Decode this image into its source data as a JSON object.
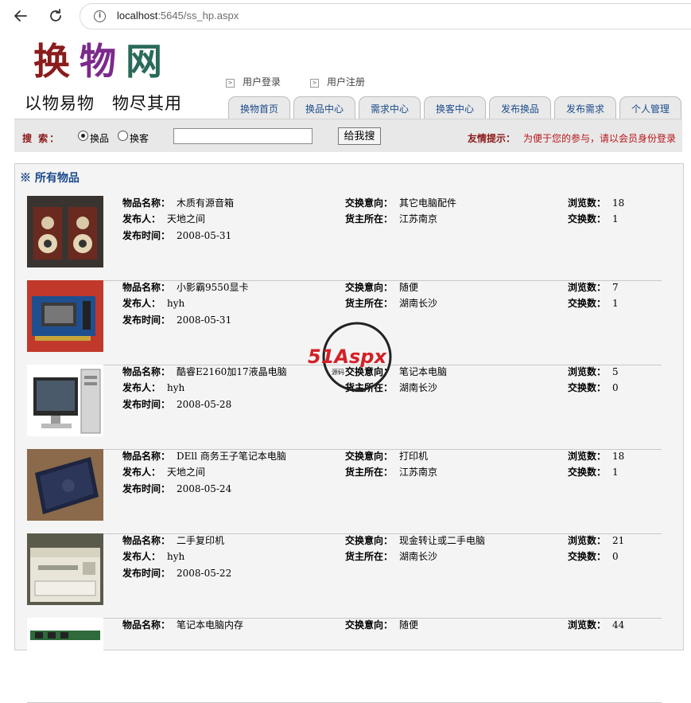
{
  "browser": {
    "url_host": "localhost",
    "url_rest": ":5645/ss_hp.aspx"
  },
  "header": {
    "logo": [
      "换",
      "物",
      "网"
    ],
    "slogan": "以物易物　物尽其用",
    "links": [
      "用户登录",
      "用户注册"
    ],
    "tabs": [
      "换物首页",
      "换品中心",
      "需求中心",
      "换客中心",
      "发布换品",
      "发布需求",
      "个人管理"
    ]
  },
  "search": {
    "label": "搜 索：",
    "options": [
      "换品",
      "换客"
    ],
    "selected": "换品",
    "input_value": "",
    "button": "给我搜",
    "tip_label": "友情提示：",
    "tip_text": "为便于您的参与，请以会员身份登录"
  },
  "listing": {
    "title": "※ 所有物品",
    "labels": {
      "name": "物品名称：",
      "poster": "发布人：",
      "time": "发布时间：",
      "want": "交换意向：",
      "location": "货主所在：",
      "views": "浏览数：",
      "swaps": "交换数："
    },
    "items": [
      {
        "name": "木质有源音箱",
        "poster": "天地之间",
        "time": "2008-05-31",
        "want": "其它电脑配件",
        "location": "江苏南京",
        "views": "18",
        "swaps": "1"
      },
      {
        "name": "小影霸9550显卡",
        "poster": "hyh",
        "time": "2008-05-31",
        "want": "随便",
        "location": "湖南长沙",
        "views": "7",
        "swaps": "1"
      },
      {
        "name": "酷睿E2160加17液晶电脑",
        "poster": "hyh",
        "time": "2008-05-28",
        "want": "笔记本电脑",
        "location": "湖南长沙",
        "views": "5",
        "swaps": "0"
      },
      {
        "name": "DEll 商务王子笔记本电脑",
        "poster": "天地之间",
        "time": "2008-05-24",
        "want": "打印机",
        "location": "江苏南京",
        "views": "18",
        "swaps": "1"
      },
      {
        "name": "二手复印机",
        "poster": "hyh",
        "time": "2008-05-22",
        "want": "现金转让或二手电脑",
        "location": "湖南长沙",
        "views": "21",
        "swaps": "0"
      },
      {
        "name": "笔记本电脑内存",
        "poster": "",
        "time": "",
        "want": "随便",
        "location": "",
        "views": "44",
        "swaps": ""
      }
    ]
  },
  "watermark": {
    "brand": "51Aspx",
    "sub": "源码"
  },
  "colors": {
    "logo1": "#8a1c1c",
    "logo2": "#7b2a8c",
    "logo3": "#2a6a5a",
    "tip": "#b8161a",
    "title": "#1a4a8c"
  }
}
